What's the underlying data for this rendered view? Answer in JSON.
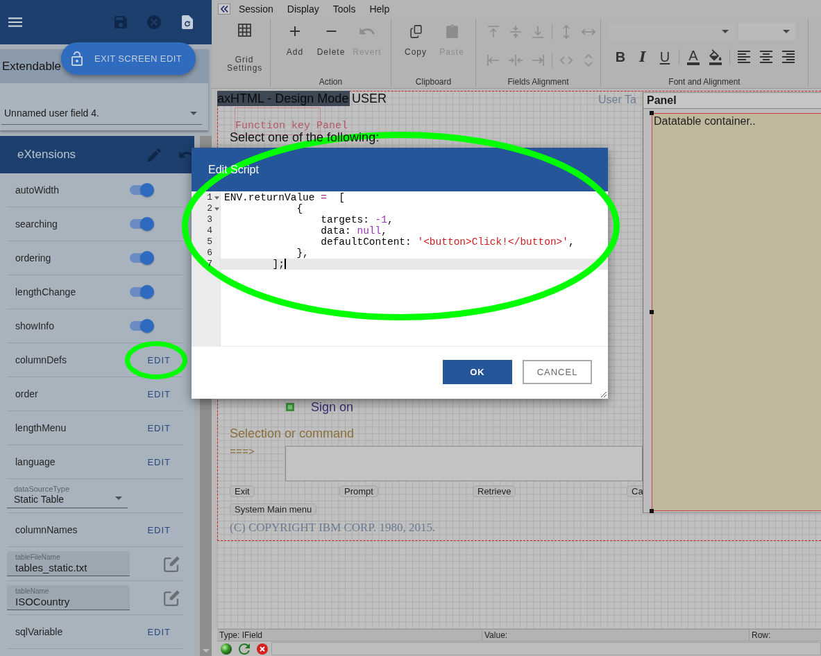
{
  "sidebar": {
    "toolbar": [
      {
        "kind": "menu",
        "disabled": false
      },
      {
        "kind": "save",
        "disabled": true
      },
      {
        "kind": "discard",
        "disabled": true
      },
      {
        "kind": "reload",
        "disabled": false
      }
    ],
    "exit_button": {
      "label": "EXIT SCREEN EDIT"
    },
    "card": {
      "title": "Extendable",
      "select": {
        "value": "Unnamed user field 4."
      }
    },
    "section": {
      "title": "eXtensions"
    },
    "properties": [
      {
        "kind": "toggle",
        "label": "autoWidth",
        "on": true,
        "circled": false
      },
      {
        "kind": "toggle",
        "label": "searching",
        "on": true,
        "circled": false
      },
      {
        "kind": "toggle",
        "label": "ordering",
        "on": true,
        "circled": false
      },
      {
        "kind": "toggle",
        "label": "lengthChange",
        "on": true,
        "circled": false
      },
      {
        "kind": "toggle",
        "label": "showInfo",
        "on": true,
        "circled": false
      },
      {
        "kind": "edit",
        "label": "columnDefs",
        "action": "EDIT",
        "circled": true
      },
      {
        "kind": "edit",
        "label": "order",
        "action": "EDIT",
        "circled": false
      },
      {
        "kind": "edit",
        "label": "lengthMenu",
        "action": "EDIT",
        "circled": false
      },
      {
        "kind": "edit",
        "label": "language",
        "action": "EDIT",
        "circled": false
      },
      {
        "kind": "select",
        "label": "dataSourceType",
        "value": "Static Table",
        "circled": false
      },
      {
        "kind": "edit",
        "label": "columnNames",
        "action": "EDIT",
        "circled": false
      },
      {
        "kind": "text",
        "label": "tableFileName",
        "value": "tables_static.txt",
        "circled": false
      },
      {
        "kind": "text",
        "label": "tableName",
        "value": "ISOCountry",
        "circled": false
      },
      {
        "kind": "edit",
        "label": "sqlVariable",
        "action": "EDIT",
        "circled": false
      }
    ]
  },
  "menu_bar": {
    "items": [
      "Session",
      "Display",
      "Tools",
      "Help"
    ]
  },
  "ribbon": {
    "groups": [
      {
        "kind": "large",
        "items": [
          {
            "kind": "grid",
            "label": "Grid Settings",
            "disabled": false
          }
        ]
      },
      {
        "kind": "large",
        "label": "Action",
        "items": [
          {
            "kind": "add",
            "label": "Add",
            "disabled": false
          },
          {
            "kind": "delete",
            "label": "Delete",
            "disabled": false
          },
          {
            "kind": "revert",
            "label": "Revert",
            "disabled": true
          }
        ]
      },
      {
        "kind": "large",
        "label": "Clipboard",
        "items": [
          {
            "kind": "copy",
            "label": "Copy",
            "disabled": false
          },
          {
            "kind": "paste",
            "label": "Paste",
            "disabled": true
          }
        ]
      },
      {
        "kind": "small",
        "label": "Fields Alignment",
        "rows": [
          {
            "items": [
              {
                "kind": "align-top",
                "disabled": true
              },
              {
                "kind": "align-middle",
                "disabled": true
              },
              {
                "kind": "align-bottom",
                "disabled": true
              },
              {
                "kind": "same-height",
                "disabled": true
              },
              {
                "kind": "same-width",
                "disabled": true
              }
            ]
          },
          {
            "items": [
              {
                "kind": "align-left",
                "disabled": true
              },
              {
                "kind": "align-center",
                "disabled": true
              },
              {
                "kind": "align-right",
                "disabled": true
              },
              {
                "kind": "space-horizontal",
                "disabled": true
              },
              {
                "kind": "space-vertical",
                "disabled": true
              }
            ]
          }
        ]
      },
      {
        "kind": "font",
        "label": "Font and Alignment",
        "buttons": [
          {
            "kind": "bold",
            "label": "B",
            "disabled": false
          },
          {
            "kind": "italic",
            "label": "I",
            "disabled": false
          },
          {
            "kind": "underline",
            "label": "U",
            "disabled": false
          },
          {
            "kind": "font-color",
            "label": "A",
            "disabled": false
          },
          {
            "kind": "fill-color",
            "disabled": false
          },
          {
            "kind": "text-left",
            "disabled": false
          },
          {
            "kind": "text-center",
            "disabled": false
          },
          {
            "kind": "text-right",
            "disabled": false
          }
        ]
      }
    ]
  },
  "design_canvas": {
    "mode_label": "axHTML - Design Mode",
    "overlay_label": "USER",
    "header_right": "User Ta",
    "function_key_panel": "Function key Panel",
    "instruction": "Select one of the following:",
    "options": [
      {
        "label": "Sign on"
      }
    ],
    "command_label": "Selection or command",
    "command_prompt": "===>",
    "function_keys": [
      {
        "label": "Exit"
      },
      {
        "label": "Prompt"
      },
      {
        "label": "Retrieve"
      },
      {
        "label": "Ca"
      },
      {
        "label": "System Main menu"
      }
    ],
    "copyright": "(C) COPYRIGHT IBM CORP. 1980, 2015.",
    "panel": {
      "title": "Panel",
      "container": "Datatable container.."
    }
  },
  "dialog": {
    "title": "Edit Script",
    "editor": {
      "circled": true,
      "lines": [
        {
          "number": "1",
          "foldable": true,
          "active": false,
          "tokens": [
            {
              "kind": "plain",
              "text": "ENV.returnValue "
            },
            {
              "kind": "operator",
              "text": "="
            },
            {
              "kind": "plain",
              "text": "  ["
            }
          ]
        },
        {
          "number": "2",
          "foldable": true,
          "active": false,
          "tokens": [
            {
              "kind": "plain",
              "text": "            {"
            }
          ]
        },
        {
          "number": "3",
          "foldable": false,
          "active": false,
          "tokens": [
            {
              "kind": "plain",
              "text": "                targets: "
            },
            {
              "kind": "number",
              "text": "-1"
            },
            {
              "kind": "plain",
              "text": ","
            }
          ]
        },
        {
          "number": "4",
          "foldable": false,
          "active": false,
          "tokens": [
            {
              "kind": "plain",
              "text": "                data: "
            },
            {
              "kind": "keyword",
              "text": "null"
            },
            {
              "kind": "plain",
              "text": ","
            }
          ]
        },
        {
          "number": "5",
          "foldable": false,
          "active": false,
          "tokens": [
            {
              "kind": "plain",
              "text": "                defaultContent: "
            },
            {
              "kind": "string",
              "text": "'<button>Click!</button>'"
            },
            {
              "kind": "plain",
              "text": ","
            }
          ]
        },
        {
          "number": "6",
          "foldable": false,
          "active": false,
          "tokens": [
            {
              "kind": "plain",
              "text": "            },"
            }
          ]
        },
        {
          "number": "7",
          "foldable": false,
          "active": true,
          "tokens": [
            {
              "kind": "plain",
              "text": "        ];"
            }
          ]
        }
      ]
    },
    "buttons": [
      {
        "kind": "primary",
        "label": "OK"
      },
      {
        "kind": "secondary",
        "label": "CANCEL"
      }
    ]
  },
  "status_bar": {
    "cells": [
      "Type: IField",
      "Value:",
      "Row:"
    ]
  }
}
